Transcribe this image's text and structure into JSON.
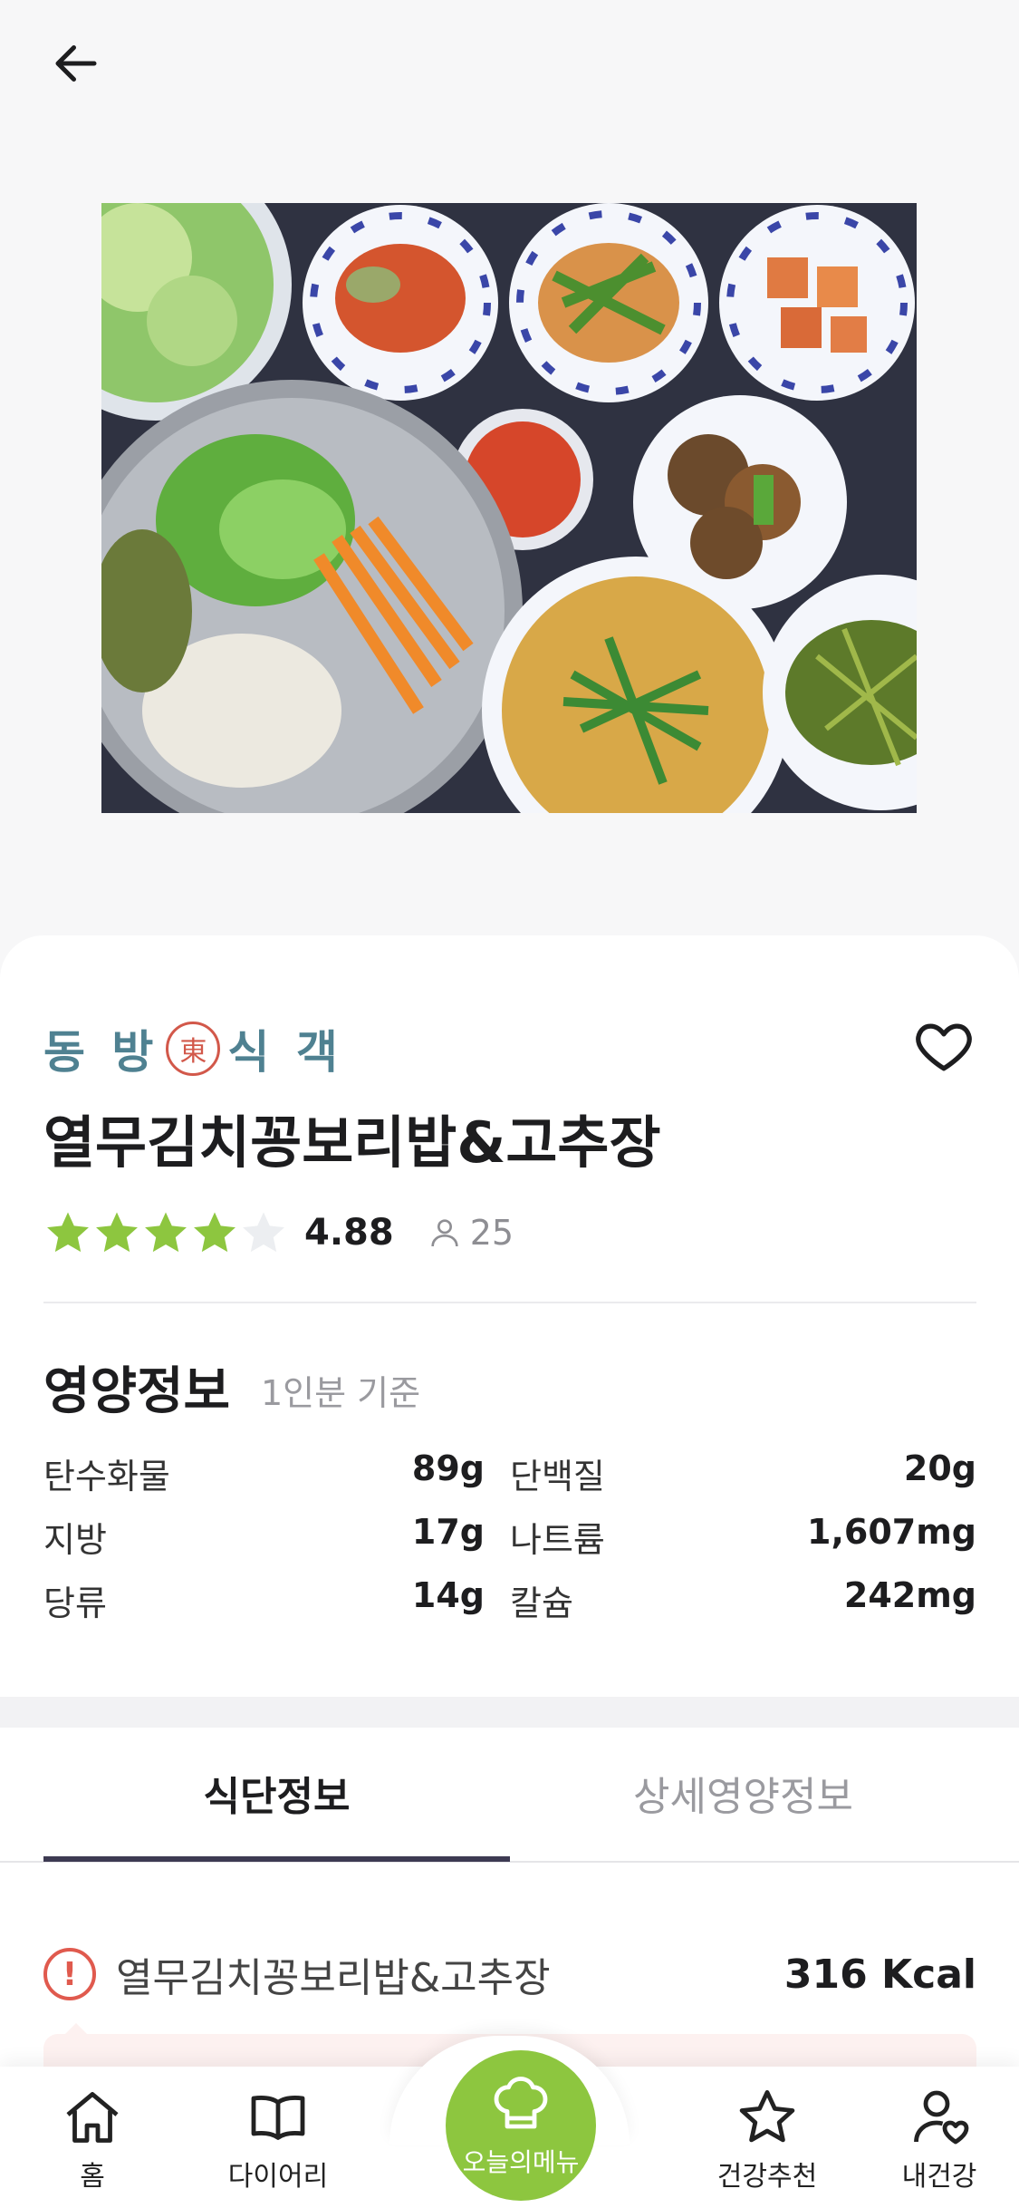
{
  "header": {
    "back_icon": "arrow-left-icon"
  },
  "hero": {
    "alt": ""
  },
  "brand": {
    "name_left": "동 방",
    "seal_char": "東",
    "name_right": "식 객"
  },
  "favorite_icon": "heart-outline-icon",
  "menu": {
    "title": "열무김치꽁보리밥&고추장",
    "rating": "4.88",
    "rating_stars_filled": 4,
    "review_count": "25"
  },
  "nutrition": {
    "title": "영양정보",
    "subtitle": "1인분 기준",
    "rows": [
      [
        {
          "label": "탄수화물",
          "value": "89g"
        },
        {
          "label": "단백질",
          "value": "20g"
        }
      ],
      [
        {
          "label": "지방",
          "value": "17g"
        },
        {
          "label": "나트륨",
          "value": "1,607mg"
        }
      ],
      [
        {
          "label": "당류",
          "value": "14g"
        },
        {
          "label": "칼슘",
          "value": "242mg"
        }
      ]
    ]
  },
  "tabs": [
    {
      "label": "식단정보"
    },
    {
      "label": "상세영양정보"
    }
  ],
  "meal": {
    "name": "열무김치꽁보리밥&고추장",
    "kcal": "316 Kcal"
  },
  "colors": {
    "accent": "#8dc63f",
    "star": "#8dc63f",
    "warn": "#e05a4e",
    "brand": "#4f8191"
  },
  "nav": {
    "items": [
      {
        "label": "홈",
        "icon": "home-icon"
      },
      {
        "label": "다이어리",
        "icon": "book-icon"
      },
      {
        "label": "오늘의메뉴",
        "icon": "chef-hat-icon"
      },
      {
        "label": "건강추천",
        "icon": "star-icon"
      },
      {
        "label": "내건강",
        "icon": "user-heart-icon"
      }
    ]
  }
}
